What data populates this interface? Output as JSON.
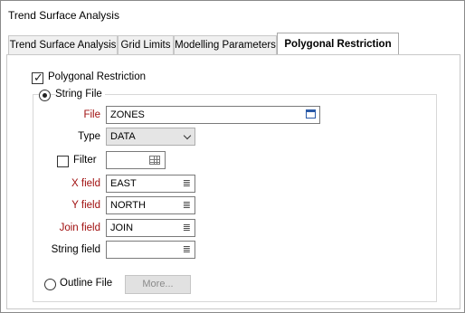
{
  "window": {
    "title": "Trend Surface Analysis"
  },
  "tabs": [
    {
      "label": "Trend Surface Analysis"
    },
    {
      "label": "Grid Limits"
    },
    {
      "label": "Modelling Parameters"
    },
    {
      "label": "Polygonal Restriction",
      "active": true
    }
  ],
  "polygonal_restriction": {
    "label": "Polygonal Restriction",
    "checked": true
  },
  "string_file": {
    "radio_label": "String File",
    "selected": true,
    "file": {
      "label": "File",
      "value": "ZONES"
    },
    "type": {
      "label": "Type",
      "value": "DATA"
    },
    "filter": {
      "label": "Filter",
      "checked": false,
      "value": ""
    },
    "x_field": {
      "label": "X field",
      "value": "EAST"
    },
    "y_field": {
      "label": "Y field",
      "value": "NORTH"
    },
    "join_field": {
      "label": "Join field",
      "value": "JOIN"
    },
    "string_field": {
      "label": "String field",
      "value": ""
    }
  },
  "outline_file": {
    "radio_label": "Outline File",
    "selected": false,
    "more_button": "More..."
  },
  "colors": {
    "required_label": "#a01010",
    "accent_icon": "#2a5aa8"
  },
  "icons": {
    "checkmark": "✓",
    "list": "≣"
  }
}
